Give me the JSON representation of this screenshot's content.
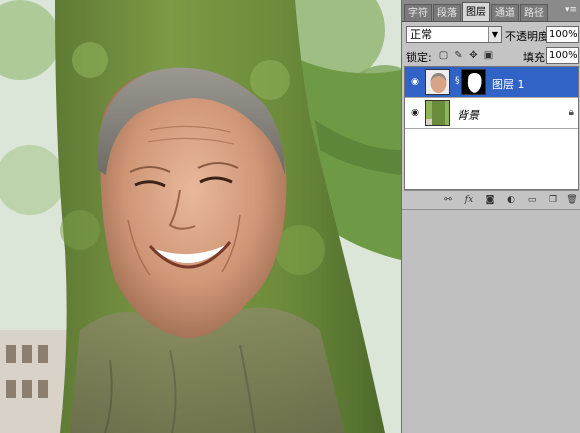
{
  "panel": {
    "tabs": [
      "字符",
      "段落",
      "图层",
      "通道",
      "路径"
    ],
    "active_tab": "图层",
    "menu_icon": "panel-menu-icon"
  },
  "blend_mode": {
    "value": "正常",
    "arrow_icon": "dropdown-arrow-icon"
  },
  "opacity": {
    "label": "不透明度:",
    "value": "100%"
  },
  "lock": {
    "label": "锁定:",
    "icons": [
      "lock-transparent-icon",
      "lock-pixels-icon",
      "lock-position-icon",
      "lock-all-icon"
    ]
  },
  "fill": {
    "label": "填充:",
    "value": "100%"
  },
  "layers": [
    {
      "name": "图层 1",
      "selected": true,
      "has_mask": true
    },
    {
      "name": "背景",
      "selected": false,
      "locked": true
    }
  ],
  "bottom_icons": [
    "link-layers-icon",
    "fx-icon",
    "add-mask-icon",
    "adjustment-layer-icon",
    "new-group-icon",
    "new-layer-icon",
    "delete-layer-icon"
  ],
  "colors": {
    "selected_row": "#3163c6",
    "panel_bg": "#c4c4c4",
    "tab_bar": "#8a8a8a"
  }
}
